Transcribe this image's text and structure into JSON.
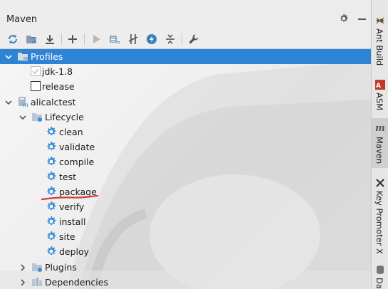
{
  "window": {
    "title": "Maven"
  },
  "toolbar": {
    "buttons": [
      "reload-icon",
      "generate-sources-icon",
      "download-icon",
      "add-icon",
      "run-icon",
      "execute-goal-icon",
      "toggle-offline-icon",
      "skip-tests-icon",
      "collapse-all-icon",
      "settings-wrench-icon"
    ]
  },
  "tree": {
    "profiles": {
      "label": "Profiles",
      "items": [
        {
          "label": "jdk-1.8",
          "checked": true
        },
        {
          "label": "release",
          "checked": false
        }
      ]
    },
    "project": {
      "label": "alicalctest"
    },
    "lifecycle": {
      "label": "Lifecycle",
      "goals": [
        "clean",
        "validate",
        "compile",
        "test",
        "package",
        "verify",
        "install",
        "site",
        "deploy"
      ]
    },
    "plugins": {
      "label": "Plugins"
    },
    "dependencies": {
      "label": "Dependencies"
    }
  },
  "right_toolbar": {
    "tabs": [
      {
        "label": "Ant Build",
        "icon": "ant-icon"
      },
      {
        "label": "ASM",
        "icon": "asm-icon"
      },
      {
        "label": "Maven",
        "icon": "maven-icon",
        "active": true
      },
      {
        "label": "Key Promoter X",
        "icon": "key-promoter-icon"
      },
      {
        "label": "Da",
        "icon": "database-icon"
      }
    ]
  },
  "colors": {
    "selection": "#2f83d4",
    "gear_blue": "#3a8fd9",
    "annotation_red": "#d63a3a"
  }
}
